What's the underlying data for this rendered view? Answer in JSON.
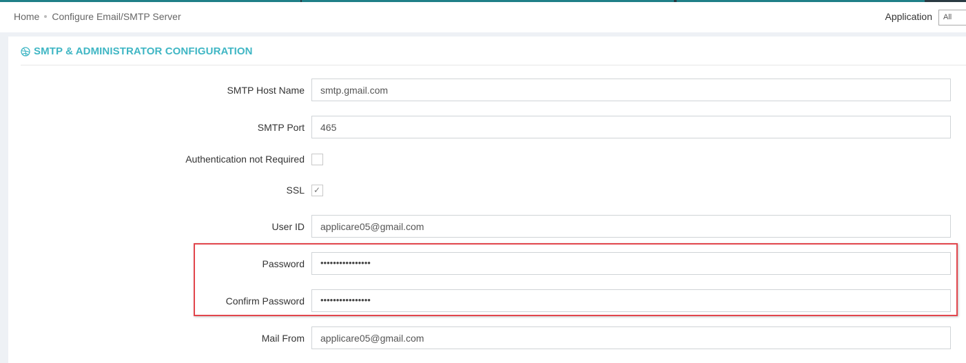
{
  "breadcrumb": {
    "home": "Home",
    "current": "Configure Email/SMTP Server"
  },
  "header": {
    "application_label": "Application",
    "application_value": "All"
  },
  "panel": {
    "title": "SMTP & ADMINISTRATOR CONFIGURATION"
  },
  "form": {
    "smtp_host": {
      "label": "SMTP Host Name",
      "value": "smtp.gmail.com"
    },
    "smtp_port": {
      "label": "SMTP Port",
      "value": "465"
    },
    "auth_not_required": {
      "label": "Authentication not Required",
      "checked": false
    },
    "ssl": {
      "label": "SSL",
      "checked": true,
      "tick": "✓"
    },
    "user_id": {
      "label": "User ID",
      "value": "applicare05@gmail.com"
    },
    "password": {
      "label": "Password",
      "value": "••••••••••••••••"
    },
    "confirm_password": {
      "label": "Confirm Password",
      "value": "••••••••••••••••"
    },
    "mail_from": {
      "label": "Mail From",
      "value": "applicare05@gmail.com"
    }
  },
  "colors": {
    "accent": "#3fb6c4",
    "highlight": "#e2454c",
    "top_strip": "#2a3a42"
  }
}
